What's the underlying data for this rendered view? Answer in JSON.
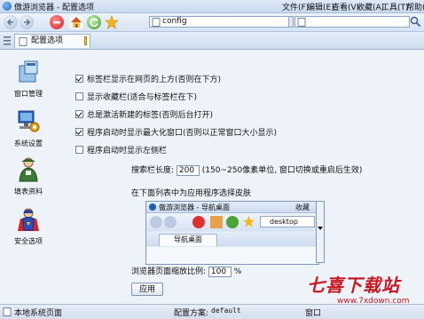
{
  "window": {
    "title": "傲游浏览器 - 配置选项"
  },
  "menu": [
    "文件(F)",
    "编辑(E)",
    "查看(V)",
    "收藏(A)",
    "工具(T)",
    "帮助(H)"
  ],
  "address": {
    "value": "config"
  },
  "tab": {
    "label": "配置选项"
  },
  "sidebar": {
    "items": [
      {
        "label": "窗口管理"
      },
      {
        "label": "系统设置"
      },
      {
        "label": "填表资料"
      },
      {
        "label": "安全选项"
      }
    ]
  },
  "options": [
    {
      "label": "标签栏显示在网页的上方(否则在下方)",
      "checked": true
    },
    {
      "label": "显示收藏栏(适合与标签栏在下)",
      "checked": false
    },
    {
      "label": "总是激活新建的标签(否则后台打开)",
      "checked": true
    },
    {
      "label": "程序启动时显示最大化窗口(否则以正常窗口大小显示)",
      "checked": true
    },
    {
      "label": "程序启动时显示左侧栏",
      "checked": false
    }
  ],
  "search_length": {
    "label": "搜索栏长度:",
    "value": "200",
    "hint": "(150~250像素单位, 窗口切换或重启后生效)"
  },
  "skin_label": "在下面列表中为应用程序选择皮肤",
  "preview": {
    "title": "傲游浏览器 - 导航桌面",
    "menu_right": "收藏",
    "address": "desktop",
    "tab": "导航桌面"
  },
  "zoom": {
    "label": "浏览器页面缩放比例:",
    "value": "100",
    "unit": "%"
  },
  "apply_button": "应用",
  "status": {
    "left": "本地系统页面",
    "scheme_label": "配置方案:",
    "scheme_value": "default",
    "right": "窗口"
  },
  "watermark": {
    "main": "七喜下载站",
    "url": "www.7xdown.com"
  },
  "colors": {
    "accent": "#1b5fb4",
    "watermark": "#c8171e"
  }
}
